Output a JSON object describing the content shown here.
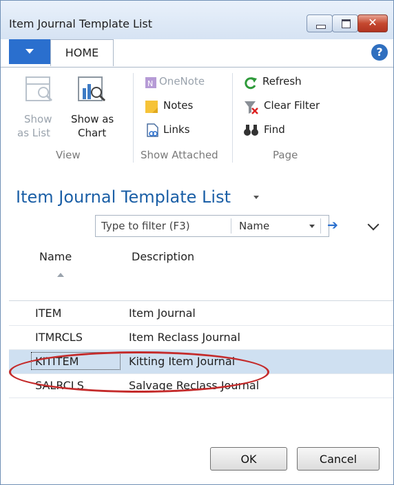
{
  "window": {
    "title": "Item Journal Template List"
  },
  "ribbon": {
    "tabs": [
      "HOME"
    ],
    "groups": {
      "view": {
        "label": "View",
        "show_as_list": "Show as List",
        "show_as_list_lines": [
          "Show",
          "as List"
        ],
        "show_as_chart_lines": [
          "Show as",
          "Chart"
        ]
      },
      "show_attached": {
        "label": "Show Attached",
        "onenote": "OneNote",
        "notes": "Notes",
        "links": "Links"
      },
      "page": {
        "label": "Page",
        "refresh": "Refresh",
        "clear_filter": "Clear Filter",
        "find": "Find"
      }
    }
  },
  "page": {
    "title": "Item Journal Template List",
    "filter": {
      "placeholder": "Type to filter (F3)",
      "field": "Name"
    }
  },
  "table": {
    "columns": [
      "Name",
      "Description"
    ],
    "rows": [
      {
        "name": "ITEM",
        "description": "Item Journal"
      },
      {
        "name": "ITMRCLS",
        "description": "Item Reclass Journal"
      },
      {
        "name": "KITITEM",
        "description": "Kitting Item Journal",
        "selected": true
      },
      {
        "name": "SALRCLS",
        "description": "Salvage Reclass Journal"
      }
    ]
  },
  "buttons": {
    "ok": "OK",
    "cancel": "Cancel"
  },
  "colors": {
    "accent": "#2a6fce",
    "title_blue": "#1b5fa6",
    "selection": "#cfe0f1",
    "highlight_ellipse": "#c42b2b"
  }
}
